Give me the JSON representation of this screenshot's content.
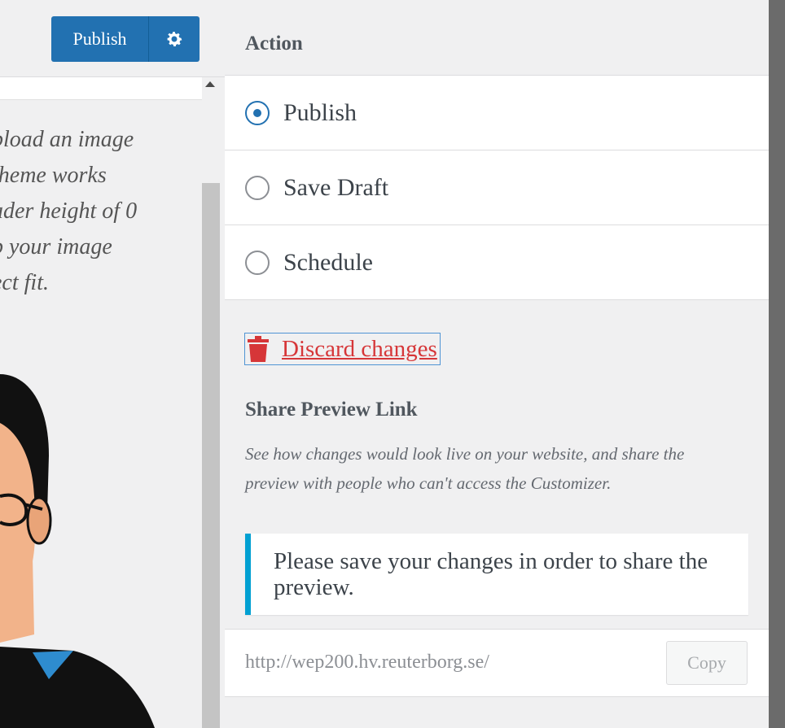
{
  "toolbar": {
    "publish_label": "Publish",
    "gear_icon": "gear-icon"
  },
  "left_preview": {
    "description_lines": [
      "pload an image",
      "theme works",
      "ader height of 0",
      "p your image",
      "ect fit."
    ]
  },
  "publish_settings": {
    "action_heading": "Action",
    "options": [
      {
        "label": "Publish",
        "checked": true
      },
      {
        "label": "Save Draft",
        "checked": false
      },
      {
        "label": "Schedule",
        "checked": false
      }
    ],
    "discard_label": "Discard changes",
    "discard_icon": "trash-icon",
    "share": {
      "title": "Share Preview Link",
      "description": "See how changes would look live on your website, and share the preview with people who can't access the Customizer.",
      "notice": "Please save your changes in order to share the preview.",
      "url": "http://wep200.hv.reuterborg.se/",
      "copy_label": "Copy"
    }
  },
  "colors": {
    "primary": "#2271b1",
    "danger": "#d63638",
    "notice_accent": "#00a0d2",
    "panel_bg": "#f0f0f1"
  }
}
